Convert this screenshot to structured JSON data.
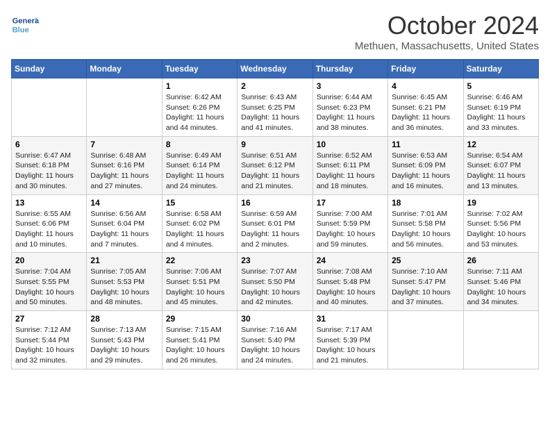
{
  "header": {
    "logo_general": "General",
    "logo_blue": "Blue",
    "month": "October 2024",
    "location": "Methuen, Massachusetts, United States"
  },
  "days_of_week": [
    "Sunday",
    "Monday",
    "Tuesday",
    "Wednesday",
    "Thursday",
    "Friday",
    "Saturday"
  ],
  "weeks": [
    [
      {
        "day": "",
        "content": ""
      },
      {
        "day": "",
        "content": ""
      },
      {
        "day": "1",
        "content": "Sunrise: 6:42 AM\nSunset: 6:26 PM\nDaylight: 11 hours and 44 minutes."
      },
      {
        "day": "2",
        "content": "Sunrise: 6:43 AM\nSunset: 6:25 PM\nDaylight: 11 hours and 41 minutes."
      },
      {
        "day": "3",
        "content": "Sunrise: 6:44 AM\nSunset: 6:23 PM\nDaylight: 11 hours and 38 minutes."
      },
      {
        "day": "4",
        "content": "Sunrise: 6:45 AM\nSunset: 6:21 PM\nDaylight: 11 hours and 36 minutes."
      },
      {
        "day": "5",
        "content": "Sunrise: 6:46 AM\nSunset: 6:19 PM\nDaylight: 11 hours and 33 minutes."
      }
    ],
    [
      {
        "day": "6",
        "content": "Sunrise: 6:47 AM\nSunset: 6:18 PM\nDaylight: 11 hours and 30 minutes."
      },
      {
        "day": "7",
        "content": "Sunrise: 6:48 AM\nSunset: 6:16 PM\nDaylight: 11 hours and 27 minutes."
      },
      {
        "day": "8",
        "content": "Sunrise: 6:49 AM\nSunset: 6:14 PM\nDaylight: 11 hours and 24 minutes."
      },
      {
        "day": "9",
        "content": "Sunrise: 6:51 AM\nSunset: 6:12 PM\nDaylight: 11 hours and 21 minutes."
      },
      {
        "day": "10",
        "content": "Sunrise: 6:52 AM\nSunset: 6:11 PM\nDaylight: 11 hours and 18 minutes."
      },
      {
        "day": "11",
        "content": "Sunrise: 6:53 AM\nSunset: 6:09 PM\nDaylight: 11 hours and 16 minutes."
      },
      {
        "day": "12",
        "content": "Sunrise: 6:54 AM\nSunset: 6:07 PM\nDaylight: 11 hours and 13 minutes."
      }
    ],
    [
      {
        "day": "13",
        "content": "Sunrise: 6:55 AM\nSunset: 6:06 PM\nDaylight: 11 hours and 10 minutes."
      },
      {
        "day": "14",
        "content": "Sunrise: 6:56 AM\nSunset: 6:04 PM\nDaylight: 11 hours and 7 minutes."
      },
      {
        "day": "15",
        "content": "Sunrise: 6:58 AM\nSunset: 6:02 PM\nDaylight: 11 hours and 4 minutes."
      },
      {
        "day": "16",
        "content": "Sunrise: 6:59 AM\nSunset: 6:01 PM\nDaylight: 11 hours and 2 minutes."
      },
      {
        "day": "17",
        "content": "Sunrise: 7:00 AM\nSunset: 5:59 PM\nDaylight: 10 hours and 59 minutes."
      },
      {
        "day": "18",
        "content": "Sunrise: 7:01 AM\nSunset: 5:58 PM\nDaylight: 10 hours and 56 minutes."
      },
      {
        "day": "19",
        "content": "Sunrise: 7:02 AM\nSunset: 5:56 PM\nDaylight: 10 hours and 53 minutes."
      }
    ],
    [
      {
        "day": "20",
        "content": "Sunrise: 7:04 AM\nSunset: 5:55 PM\nDaylight: 10 hours and 50 minutes."
      },
      {
        "day": "21",
        "content": "Sunrise: 7:05 AM\nSunset: 5:53 PM\nDaylight: 10 hours and 48 minutes."
      },
      {
        "day": "22",
        "content": "Sunrise: 7:06 AM\nSunset: 5:51 PM\nDaylight: 10 hours and 45 minutes."
      },
      {
        "day": "23",
        "content": "Sunrise: 7:07 AM\nSunset: 5:50 PM\nDaylight: 10 hours and 42 minutes."
      },
      {
        "day": "24",
        "content": "Sunrise: 7:08 AM\nSunset: 5:48 PM\nDaylight: 10 hours and 40 minutes."
      },
      {
        "day": "25",
        "content": "Sunrise: 7:10 AM\nSunset: 5:47 PM\nDaylight: 10 hours and 37 minutes."
      },
      {
        "day": "26",
        "content": "Sunrise: 7:11 AM\nSunset: 5:46 PM\nDaylight: 10 hours and 34 minutes."
      }
    ],
    [
      {
        "day": "27",
        "content": "Sunrise: 7:12 AM\nSunset: 5:44 PM\nDaylight: 10 hours and 32 minutes."
      },
      {
        "day": "28",
        "content": "Sunrise: 7:13 AM\nSunset: 5:43 PM\nDaylight: 10 hours and 29 minutes."
      },
      {
        "day": "29",
        "content": "Sunrise: 7:15 AM\nSunset: 5:41 PM\nDaylight: 10 hours and 26 minutes."
      },
      {
        "day": "30",
        "content": "Sunrise: 7:16 AM\nSunset: 5:40 PM\nDaylight: 10 hours and 24 minutes."
      },
      {
        "day": "31",
        "content": "Sunrise: 7:17 AM\nSunset: 5:39 PM\nDaylight: 10 hours and 21 minutes."
      },
      {
        "day": "",
        "content": ""
      },
      {
        "day": "",
        "content": ""
      }
    ]
  ]
}
